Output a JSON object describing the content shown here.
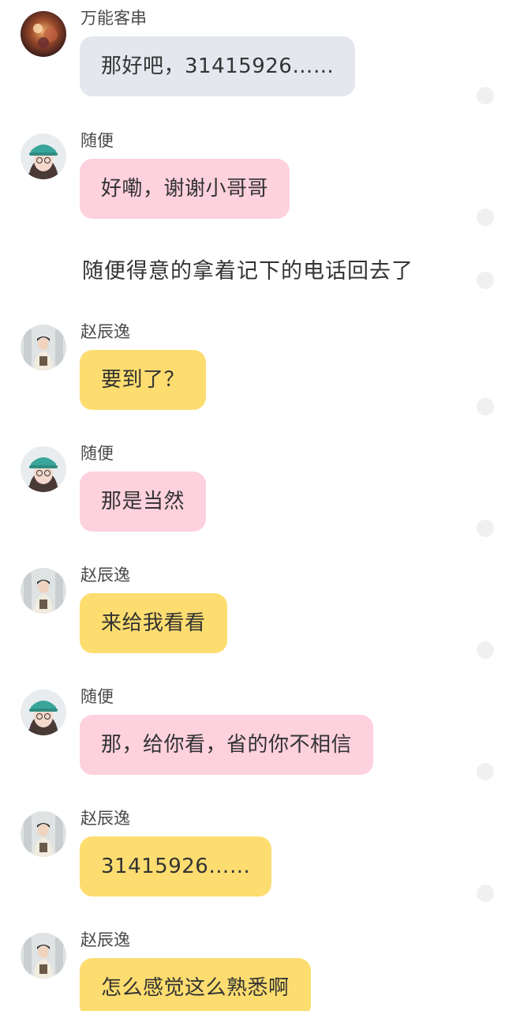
{
  "colors": {
    "bubble_gray": "#e4e8ee",
    "bubble_pink": "#fdd1dd",
    "bubble_yellow": "#fddd70",
    "background": "#ffffff",
    "text": "#333333"
  },
  "messages": [
    {
      "type": "bubble",
      "speaker": "万能客串",
      "avatar": "avatar-wanneng-icon",
      "text": "那好吧，31415926……",
      "bubble_color": "gray"
    },
    {
      "type": "bubble",
      "speaker": "随便",
      "avatar": "avatar-suibian-icon",
      "text": "好嘞，谢谢小哥哥",
      "bubble_color": "pink"
    },
    {
      "type": "narration",
      "text": "随便得意的拿着记下的电话回去了"
    },
    {
      "type": "bubble",
      "speaker": "赵辰逸",
      "avatar": "avatar-zhaochenyi-icon",
      "text": "要到了？",
      "bubble_color": "yellow"
    },
    {
      "type": "bubble",
      "speaker": "随便",
      "avatar": "avatar-suibian-icon",
      "text": "那是当然",
      "bubble_color": "pink"
    },
    {
      "type": "bubble",
      "speaker": "赵辰逸",
      "avatar": "avatar-zhaochenyi-icon",
      "text": "来给我看看",
      "bubble_color": "yellow"
    },
    {
      "type": "bubble",
      "speaker": "随便",
      "avatar": "avatar-suibian-icon",
      "text": "那，给你看，省的你不相信",
      "bubble_color": "pink"
    },
    {
      "type": "bubble",
      "speaker": "赵辰逸",
      "avatar": "avatar-zhaochenyi-icon",
      "text": "31415926……",
      "bubble_color": "yellow"
    },
    {
      "type": "bubble",
      "speaker": "赵辰逸",
      "avatar": "avatar-zhaochenyi-icon",
      "text": "怎么感觉这么熟悉啊",
      "bubble_color": "yellow"
    }
  ]
}
